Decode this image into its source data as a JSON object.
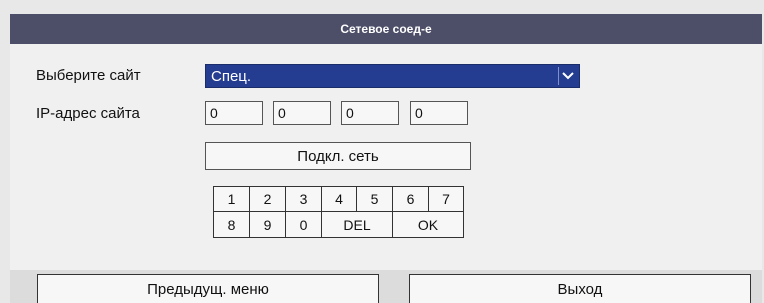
{
  "window": {
    "title": "Сетевое соед-е"
  },
  "form": {
    "site_label": "Выберите сайт",
    "site_value": "Спец.",
    "ip_label": "IP-адрес сайта",
    "ip_octets": [
      "0",
      "0",
      "0",
      "0"
    ],
    "connect_label": "Подкл. сеть"
  },
  "keypad": {
    "row1": [
      "1",
      "2",
      "3",
      "4",
      "5",
      "6",
      "7"
    ],
    "row2": [
      "8",
      "9",
      "0",
      "DEL",
      "OK"
    ]
  },
  "footer": {
    "prev_label": "Предыдущ. меню",
    "exit_label": "Выход"
  },
  "icons": {
    "dropdown": "chevron-down-icon"
  },
  "colors": {
    "titlebar": "#4d4f68",
    "select_bg": "#243d90"
  }
}
